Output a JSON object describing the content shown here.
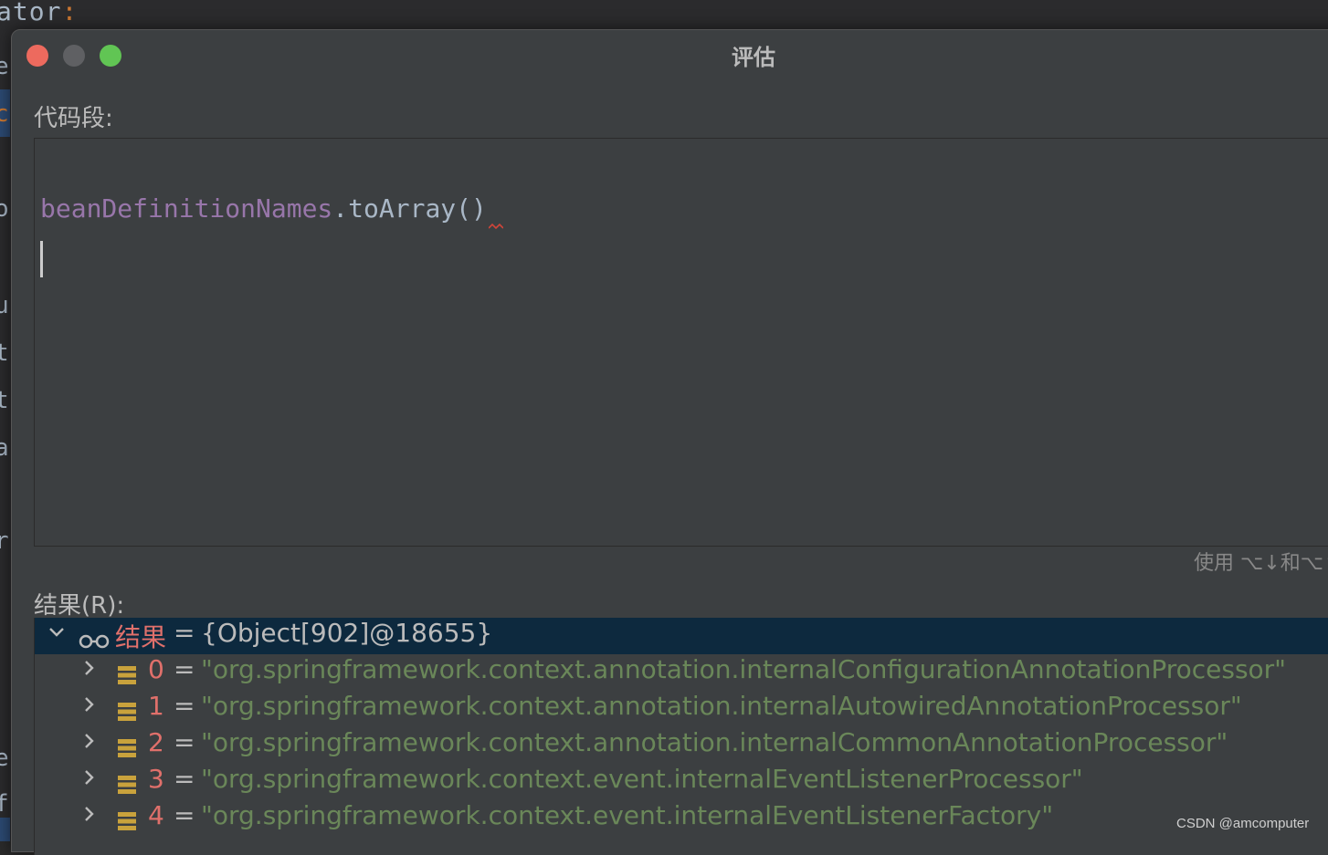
{
  "background": {
    "top_code": "ator",
    "top_code_colon": ":",
    "gutter_chars": [
      "e",
      "c",
      "o",
      "u",
      "t",
      "t",
      "a",
      "r",
      "e",
      "f"
    ]
  },
  "dialog": {
    "title": "评估",
    "code_label": "代码段:",
    "code": {
      "identifier": "beanDefinitionNames",
      "dot": ".",
      "method": "toArray",
      "parens": "()"
    },
    "hint": "使用 ⌥↓和⌥↑",
    "result_label": "结果(R):",
    "tree": {
      "root": {
        "name": "结果",
        "eq": "=",
        "value": "{Object[902]@18655}"
      },
      "items": [
        {
          "index": "0",
          "eq": "=",
          "value": "\"org.springframework.context.annotation.internalConfigurationAnnotationProcessor\""
        },
        {
          "index": "1",
          "eq": "=",
          "value": "\"org.springframework.context.annotation.internalAutowiredAnnotationProcessor\""
        },
        {
          "index": "2",
          "eq": "=",
          "value": "\"org.springframework.context.annotation.internalCommonAnnotationProcessor\""
        },
        {
          "index": "3",
          "eq": "=",
          "value": "\"org.springframework.context.event.internalEventListenerProcessor\""
        },
        {
          "index": "4",
          "eq": "=",
          "value": "\"org.springframework.context.event.internalEventListenerFactory\""
        }
      ]
    }
  },
  "watermark": "CSDN @amcomputer",
  "colors": {
    "dialog_bg": "#3c3f41",
    "selection": "#0d293e",
    "string": "#6a8759",
    "field": "#9876aa",
    "index": "#e0706b",
    "close": "#ed6a5e",
    "maximize": "#61c554"
  },
  "icons": [
    "close-button",
    "minimize-button",
    "maximize-button",
    "chevron-down-icon",
    "chevron-right-icon",
    "watch-glasses-icon",
    "array-element-icon"
  ]
}
